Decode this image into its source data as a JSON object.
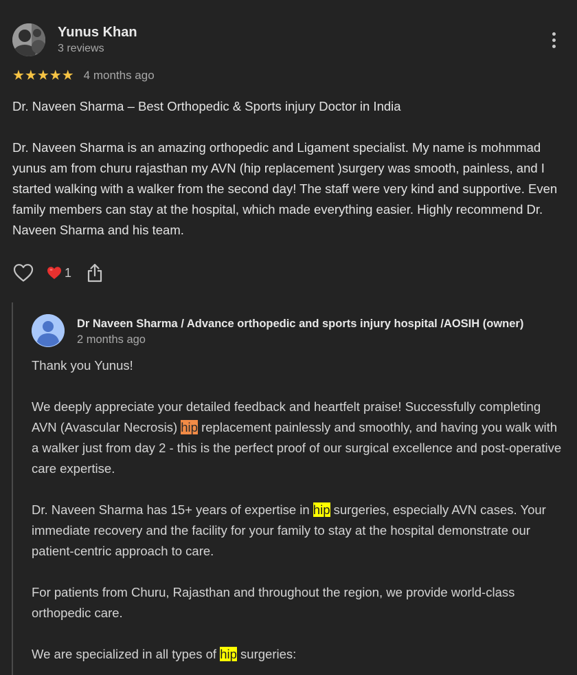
{
  "review": {
    "author_name": "Yunus Khan",
    "review_count": "3 reviews",
    "stars": "★★★★★",
    "rating": 5,
    "time": "4 months ago",
    "paragraphs": [
      "Dr. Naveen Sharma – Best Orthopedic & Sports injury Doctor in India",
      "Dr. Naveen Sharma is an amazing orthopedic and Ligament specialist. My name is mohmmad yunus am from churu rajasthan my AVN (hip replacement )surgery was smooth, painless, and I started walking with a walker from the second day! The staff were very kind and supportive. Even family members can stay at the hospital, which made everything easier. Highly recommend Dr. Naveen Sharma and his team."
    ],
    "reaction_emoji": "❤️",
    "reaction_count": "1",
    "icons": {
      "more": "more-vert-icon",
      "like": "heart-outline-icon",
      "share": "share-icon"
    }
  },
  "reply": {
    "owner_name": "Dr Naveen Sharma / Advance orthopedic and sports injury hospital /AOSIH (owner)",
    "time": "2 months ago",
    "p1": "Thank you Yunus!",
    "p2": {
      "a": "We deeply appreciate your detailed feedback and heartfelt praise! Successfully completing AVN (Avascular Necrosis) ",
      "hl": "hip",
      "b": " replacement painlessly and smoothly, and having you walk with a walker just from day 2 - this is the perfect proof of our surgical excellence and post-operative care expertise."
    },
    "p3": {
      "a": "Dr. Naveen Sharma has 15+ years of expertise in ",
      "hl": "hip",
      "b": " surgeries, especially AVN cases. Your immediate recovery and the facility for your family to stay at the hospital demonstrate our patient-centric approach to care."
    },
    "p4": "For patients from Churu, Rajasthan and throughout the region, we provide world-class orthopedic care.",
    "p5": {
      "a": "We are specialized in all types of ",
      "hl": "hip",
      "b": " surgeries:"
    }
  },
  "colors": {
    "background": "#232323",
    "star": "#f6c344",
    "highlight_current": "#f28b46",
    "highlight": "#ffff00",
    "owner_avatar": "#a8c7fa"
  }
}
